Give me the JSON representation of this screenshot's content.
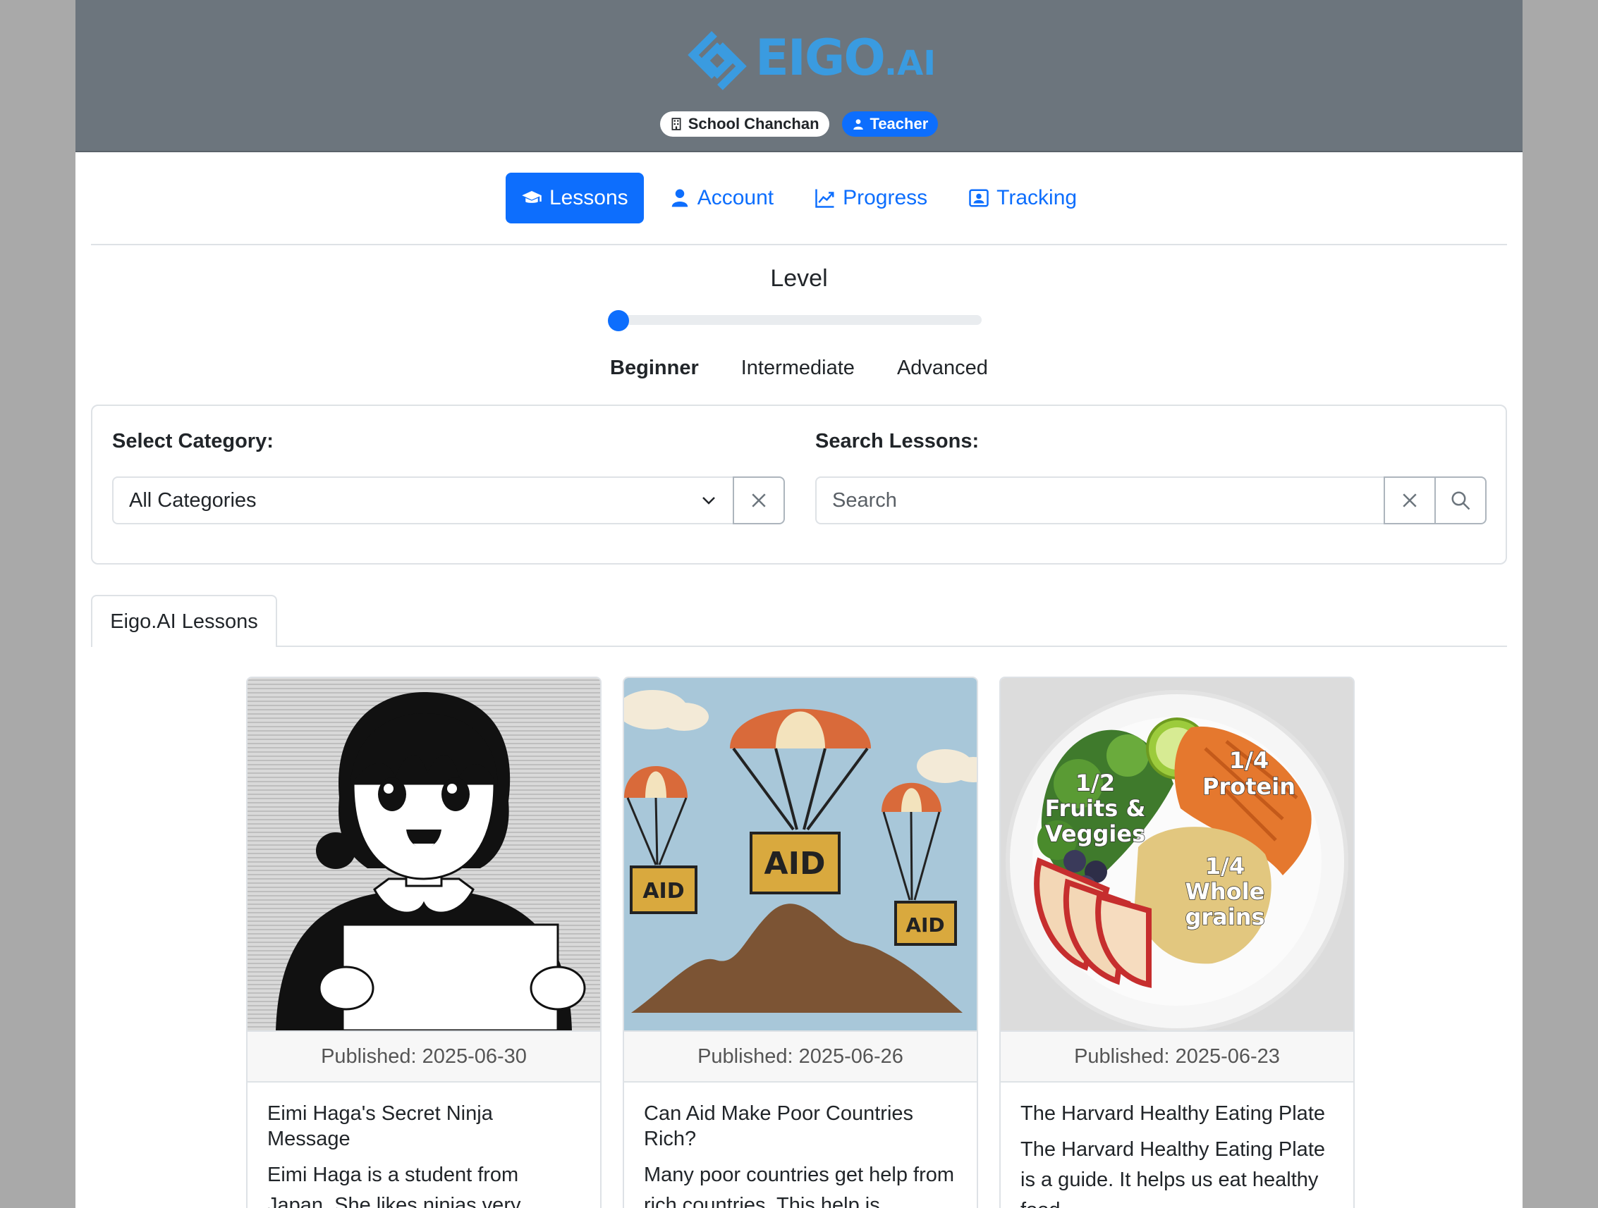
{
  "brand": {
    "name": "EIGO",
    "suffix": ".AI",
    "color": "#3a9be0"
  },
  "header": {
    "school_badge": "School Chanchan",
    "role_badge": "Teacher"
  },
  "nav": {
    "items": [
      {
        "label": "Lessons",
        "icon": "graduation-cap-icon",
        "active": true
      },
      {
        "label": "Account",
        "icon": "user-icon",
        "active": false
      },
      {
        "label": "Progress",
        "icon": "chart-line-icon",
        "active": false
      },
      {
        "label": "Tracking",
        "icon": "person-badge-icon",
        "active": false
      }
    ]
  },
  "level": {
    "title": "Level",
    "options": [
      "Beginner",
      "Intermediate",
      "Advanced"
    ],
    "selected": "Beginner",
    "slider_value": 0
  },
  "filters": {
    "category_label": "Select Category:",
    "category_value": "All Categories",
    "search_label": "Search Lessons:",
    "search_placeholder": "Search"
  },
  "tabs": {
    "active": "Eigo.AI Lessons"
  },
  "lessons": [
    {
      "published": "Published: 2025-06-30",
      "title": "Eimi Haga's Secret Ninja Message",
      "text": "Eimi Haga is a student from Japan. She likes ninjas very"
    },
    {
      "published": "Published: 2025-06-26",
      "title": "Can Aid Make Poor Countries Rich?",
      "text": "Many poor countries get help from rich countries. This help is"
    },
    {
      "published": "Published: 2025-06-23",
      "title": "The Harvard Healthy Eating Plate",
      "text": "The Harvard Healthy Eating Plate is a guide. It helps us eat healthy food."
    }
  ],
  "image_labels": {
    "aid": "AID",
    "veggies": [
      "1/2",
      "Fruits &",
      "Veggies"
    ],
    "protein": [
      "1/4",
      "Protein"
    ],
    "grains": [
      "1/4",
      "Whole",
      "grains"
    ]
  },
  "colors": {
    "primary": "#0d6efd",
    "header_bg": "#6c757d"
  }
}
